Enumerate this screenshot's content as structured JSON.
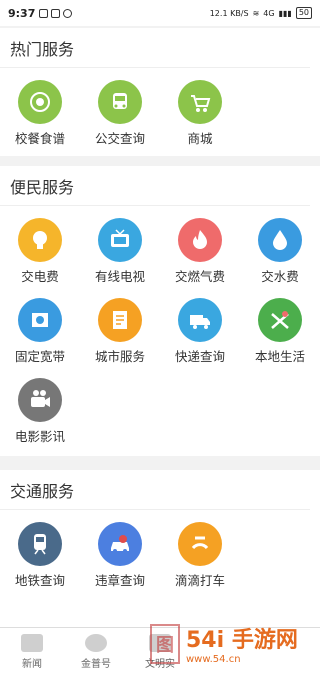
{
  "status": {
    "time": "9:37",
    "speed": "12.1 KB/S",
    "signal": "4G",
    "battery": "50"
  },
  "hot": {
    "title": "热门服务",
    "items": [
      {
        "label": "校餐食谱",
        "icon": "meal-icon",
        "color": "#8cc44a"
      },
      {
        "label": "公交查询",
        "icon": "bus-icon",
        "color": "#8cc44a"
      },
      {
        "label": "商城",
        "icon": "cart-icon",
        "color": "#8cc44a"
      }
    ]
  },
  "life": {
    "title": "便民服务",
    "items": [
      {
        "label": "交电费",
        "icon": "bulb-icon",
        "color": "#f5b52b"
      },
      {
        "label": "有线电视",
        "icon": "tv-icon",
        "color": "#3aa7e0"
      },
      {
        "label": "交燃气费",
        "icon": "flame-icon",
        "color": "#ef6b6b"
      },
      {
        "label": "交水费",
        "icon": "drop-icon",
        "color": "#3a9be0"
      },
      {
        "label": "固定宽带",
        "icon": "broadband-icon",
        "color": "#3a9be0"
      },
      {
        "label": "城市服务",
        "icon": "document-icon",
        "color": "#f5a123"
      },
      {
        "label": "快递查询",
        "icon": "truck-icon",
        "color": "#3aa7e0"
      },
      {
        "label": "本地生活",
        "icon": "map-pin-icon",
        "color": "#4cae4c"
      },
      {
        "label": "电影影讯",
        "icon": "camera-icon",
        "color": "#777777"
      }
    ]
  },
  "traffic": {
    "title": "交通服务",
    "items": [
      {
        "label": "地铁查询",
        "icon": "subway-icon",
        "color": "#4a6a8a"
      },
      {
        "label": "违章查询",
        "icon": "car-icon",
        "color": "#4c7fe0"
      },
      {
        "label": "滴滴打车",
        "icon": "didi-icon",
        "color": "#f5a123"
      }
    ]
  },
  "nav": [
    {
      "label": "新闻"
    },
    {
      "label": "金普号"
    },
    {
      "label": "文明实"
    }
  ],
  "watermark": {
    "seal": "图",
    "text": "54i 手游网",
    "sub": "www.54.cn"
  }
}
